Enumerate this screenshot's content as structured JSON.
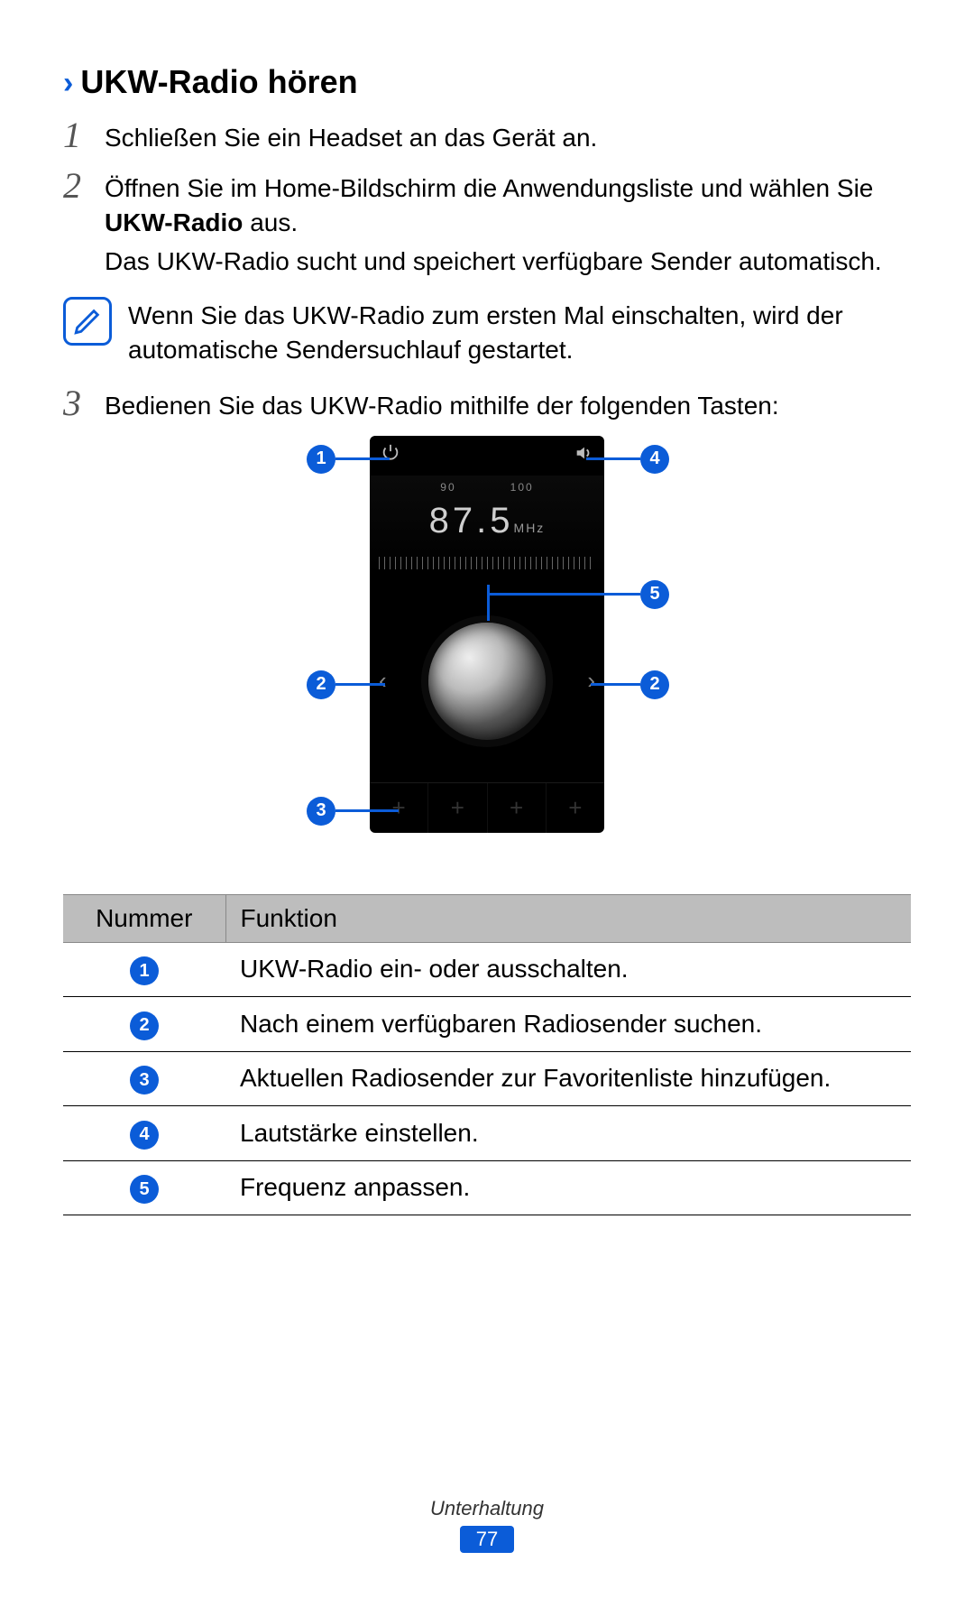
{
  "heading": "UKW-Radio hören",
  "steps": {
    "s1": {
      "num": "1",
      "text": "Schließen Sie ein Headset an das Gerät an."
    },
    "s2": {
      "num": "2",
      "line1a": "Öffnen Sie im Home-Bildschirm die Anwendungsliste und wählen Sie ",
      "bold": "UKW-Radio",
      "line1b": " aus.",
      "line2": "Das UKW-Radio sucht und speichert verfügbare Sender automatisch."
    },
    "s3": {
      "num": "3",
      "text": "Bedienen Sie das UKW-Radio mithilfe der folgenden Tasten:"
    }
  },
  "note": "Wenn Sie das UKW-Radio zum ersten Mal einschalten, wird der automatische Sendersuchlauf gestartet.",
  "radio": {
    "scale_left": "90",
    "scale_right": "100",
    "frequency": "87.5",
    "unit": "MHz"
  },
  "callouts": {
    "c1": "1",
    "c2": "2",
    "c3": "3",
    "c4": "4",
    "c5": "5"
  },
  "table": {
    "h1": "Nummer",
    "h2": "Funktion",
    "r1": "UKW-Radio ein- oder ausschalten.",
    "r2": "Nach einem verfügbaren Radiosender suchen.",
    "r3": "Aktuellen Radiosender zur Favoritenliste hinzufügen.",
    "r4": "Lautstärke einstellen.",
    "r5": "Frequenz anpassen."
  },
  "footer": {
    "section": "Unterhaltung",
    "page": "77"
  }
}
